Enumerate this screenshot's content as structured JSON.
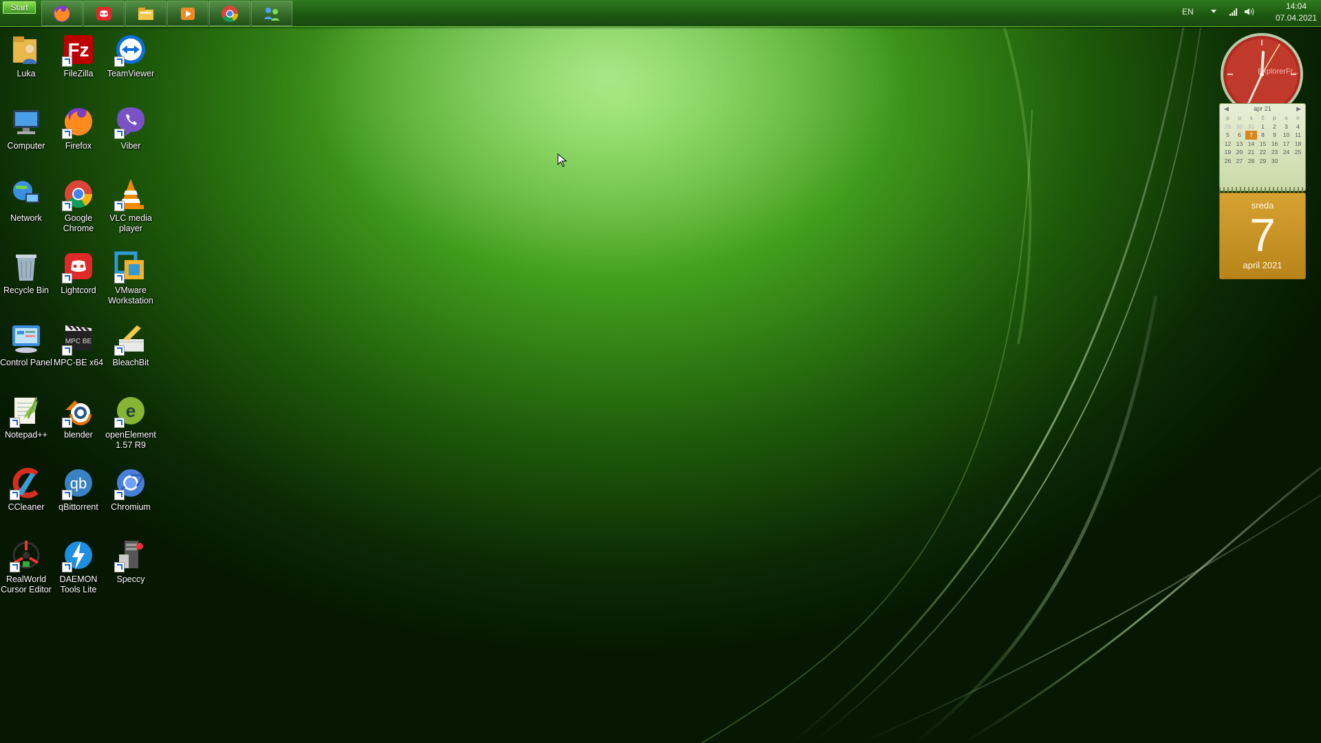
{
  "taskbar": {
    "start_label": "Start",
    "pinned": [
      "firefox-icon",
      "lightcord-icon",
      "file-explorer-icon",
      "media-player-icon",
      "chrome-icon",
      "network-users-icon"
    ],
    "tray": {
      "language": "EN",
      "time": "14:04",
      "date": "07.04.2021"
    }
  },
  "desktop": {
    "icons": [
      {
        "label": "Luka",
        "icon": "user-folder-icon"
      },
      {
        "label": "FileZilla",
        "icon": "filezilla-icon"
      },
      {
        "label": "TeamViewer",
        "icon": "teamviewer-icon"
      },
      {
        "label": "Computer",
        "icon": "computer-icon"
      },
      {
        "label": "Firefox",
        "icon": "firefox-icon"
      },
      {
        "label": "Viber",
        "icon": "viber-icon"
      },
      {
        "label": "Network",
        "icon": "network-icon"
      },
      {
        "label": "Google Chrome",
        "icon": "chrome-icon"
      },
      {
        "label": "VLC media player",
        "icon": "vlc-icon"
      },
      {
        "label": "Recycle Bin",
        "icon": "recycle-bin-icon"
      },
      {
        "label": "Lightcord",
        "icon": "lightcord-icon"
      },
      {
        "label": "VMware Workstation",
        "icon": "vmware-icon"
      },
      {
        "label": "Control Panel",
        "icon": "control-panel-icon"
      },
      {
        "label": "MPC-BE x64",
        "icon": "mpc-be-icon"
      },
      {
        "label": "BleachBit",
        "icon": "bleachbit-icon"
      },
      {
        "label": "Notepad++",
        "icon": "notepadpp-icon"
      },
      {
        "label": "blender",
        "icon": "blender-icon"
      },
      {
        "label": "openElement 1.57 R9",
        "icon": "openelement-icon"
      },
      {
        "label": "CCleaner",
        "icon": "ccleaner-icon"
      },
      {
        "label": "qBittorrent",
        "icon": "qbittorrent-icon"
      },
      {
        "label": "Chromium",
        "icon": "chromium-icon"
      },
      {
        "label": "RealWorld Cursor Editor",
        "icon": "realworld-icon"
      },
      {
        "label": "DAEMON Tools Lite",
        "icon": "daemon-tools-icon"
      },
      {
        "label": "Speccy",
        "icon": "speccy-icon"
      }
    ]
  },
  "gadgets": {
    "clock": {
      "label": "ExplorerFr..."
    },
    "calendar": {
      "month_label": "apr 21",
      "weekdays": [
        "p",
        "u",
        "s",
        "č",
        "p",
        "s",
        "n"
      ],
      "weeks": [
        [
          "29",
          "30",
          "31",
          "1",
          "2",
          "3",
          "4"
        ],
        [
          "5",
          "6",
          "7",
          "8",
          "9",
          "10",
          "11"
        ],
        [
          "12",
          "13",
          "14",
          "15",
          "16",
          "17",
          "18"
        ],
        [
          "19",
          "20",
          "21",
          "22",
          "23",
          "24",
          "25"
        ],
        [
          "26",
          "27",
          "28",
          "29",
          "30",
          "",
          ""
        ]
      ],
      "today": "7"
    },
    "day_card": {
      "weekday": "sreda",
      "day": "7",
      "month_year": "april 2021"
    }
  }
}
